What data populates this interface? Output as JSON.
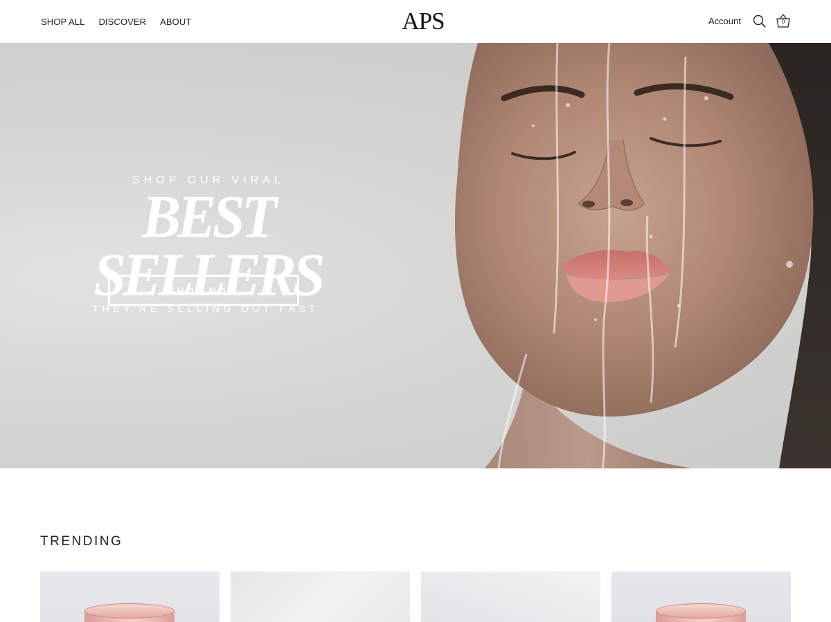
{
  "header": {
    "nav": [
      "SHOP ALL",
      "DISCOVER",
      "ABOUT"
    ],
    "logo": "APS",
    "account_label": "Account",
    "cart_count": "0",
    "icons": [
      "search-icon",
      "basket-icon"
    ]
  },
  "hero": {
    "eyebrow": "SHOP OUR VIRAL",
    "headline": "BEST SELLERS",
    "subline": "THEY'RE SELLING OUT FAST",
    "cta_label": "SHOP NOW",
    "text_color": "#ffffff"
  },
  "trending": {
    "title": "TRENDING"
  },
  "colors": {
    "text": "#222222",
    "background": "#ffffff",
    "product_pink": "#e9b3ab"
  }
}
